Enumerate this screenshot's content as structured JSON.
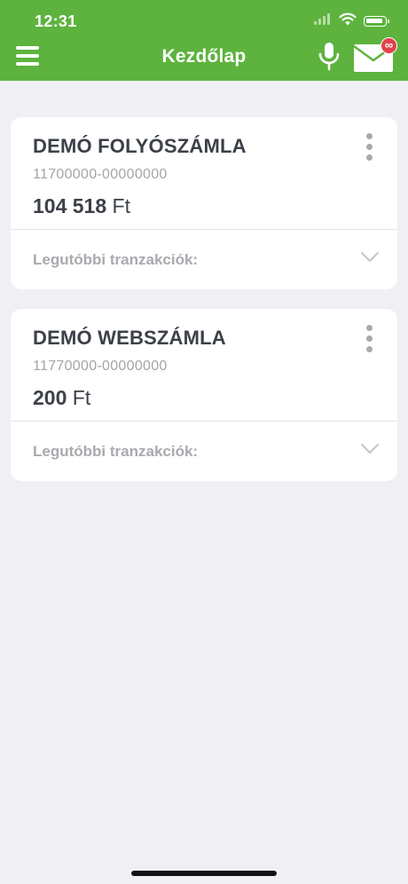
{
  "status_bar": {
    "time": "12:31",
    "icons": [
      "signal-icon",
      "wifi-icon",
      "battery-icon"
    ]
  },
  "header": {
    "title": "Kezdőlap",
    "menu_icon": "hamburger-menu-icon",
    "mic_icon": "microphone-icon",
    "mail_icon": "mail-icon",
    "mail_badge": "∞"
  },
  "colors": {
    "header": "#5db33e",
    "background": "#efeff4",
    "badge": "#e2424b"
  },
  "accounts": [
    {
      "name": "DEMÓ FOLYÓSZÁMLA",
      "number": "11700000-00000000",
      "amount": "104 518",
      "currency": "Ft",
      "transactions_label": "Legutóbbi tranzakciók:"
    },
    {
      "name": "DEMÓ WEBSZÁMLA",
      "number": "11770000-00000000",
      "amount": "200",
      "currency": "Ft",
      "transactions_label": "Legutóbbi tranzakciók:"
    }
  ]
}
